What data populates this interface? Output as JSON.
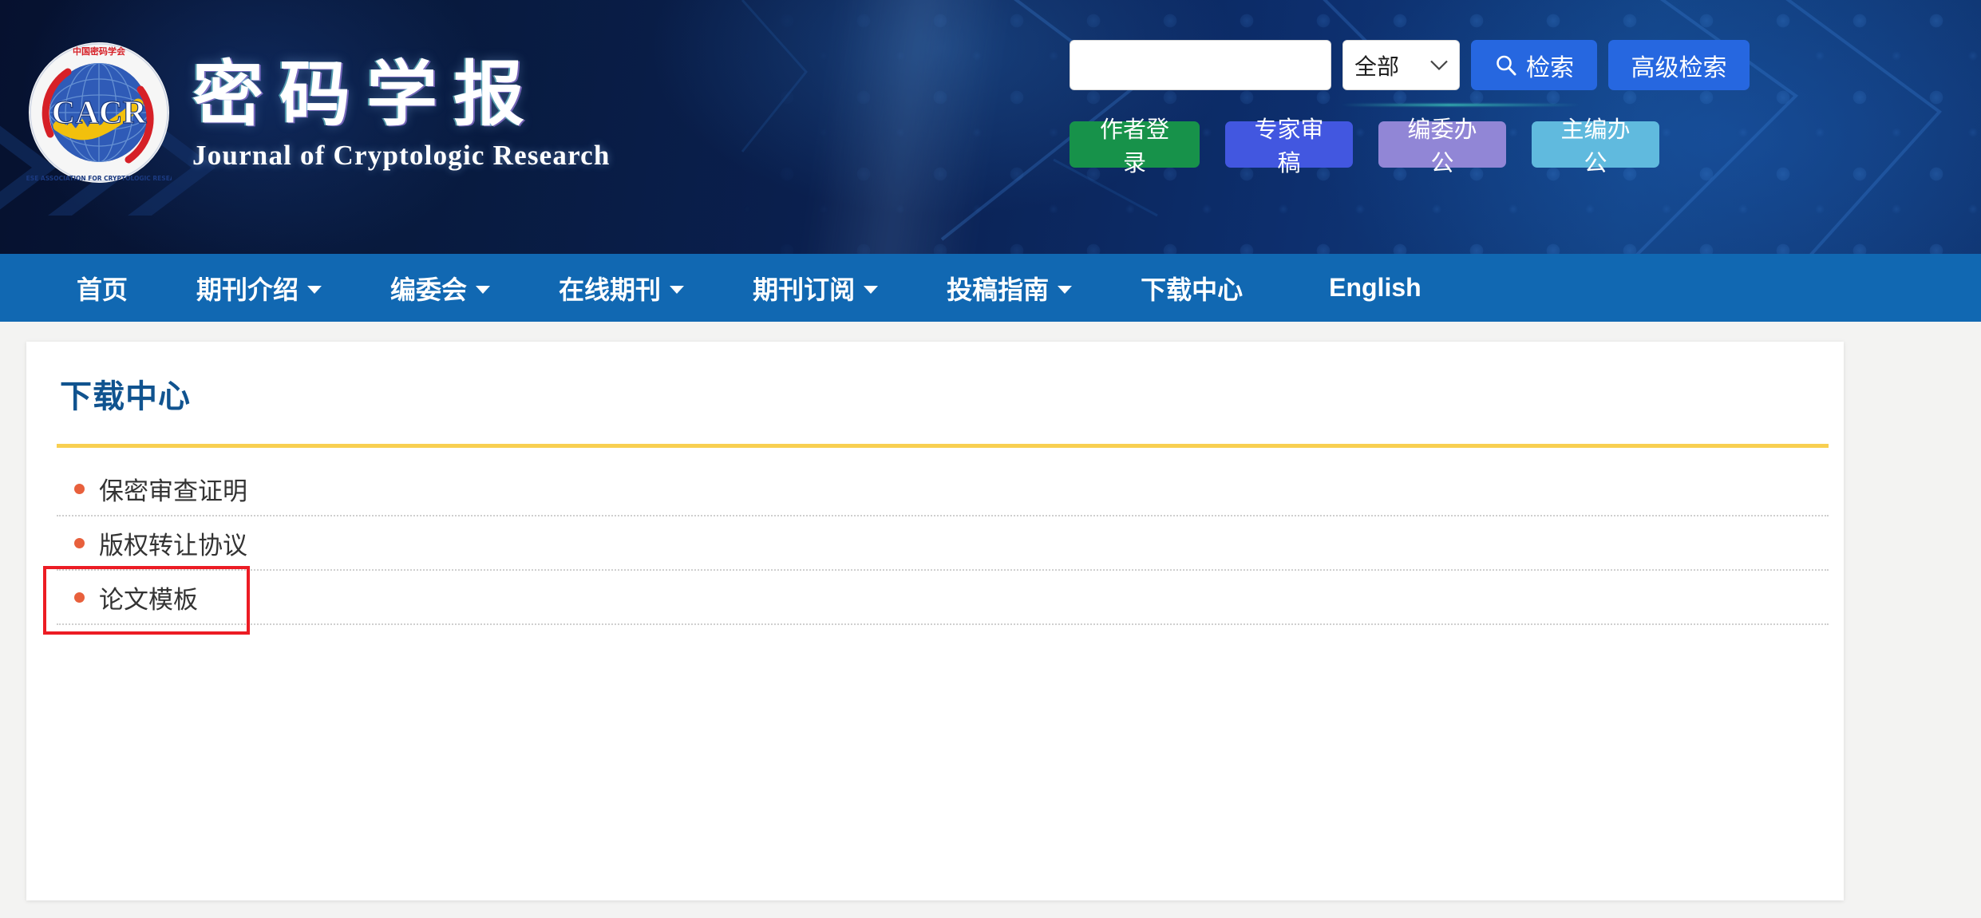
{
  "site": {
    "logo_icon": "cacr-emblem-icon",
    "title_cn": "密码学报",
    "title_en": "Journal of Cryptologic Research"
  },
  "search": {
    "query_value": "",
    "placeholder": "",
    "scope_selected": "全部",
    "scope_chevron_icon": "chevron-down-icon",
    "search_icon": "search-icon",
    "search_label": "检索",
    "advanced_label": "高级检索"
  },
  "account_buttons": [
    {
      "label": "作者登录",
      "color": "#17924a"
    },
    {
      "label": "专家审稿",
      "color": "#4257e0"
    },
    {
      "label": "编委办公",
      "color": "#9186d6"
    },
    {
      "label": "主编办公",
      "color": "#60bade"
    }
  ],
  "nav": {
    "bg_color": "#1168b2",
    "items": [
      {
        "label": "首页",
        "has_caret": false
      },
      {
        "label": "期刊介绍",
        "has_caret": true
      },
      {
        "label": "编委会",
        "has_caret": true
      },
      {
        "label": "在线期刊",
        "has_caret": true
      },
      {
        "label": "期刊订阅",
        "has_caret": true
      },
      {
        "label": "投稿指南",
        "has_caret": true
      },
      {
        "label": "下载中心",
        "has_caret": false
      },
      {
        "label": "English",
        "has_caret": false
      }
    ]
  },
  "main": {
    "page_title": "下载中心",
    "title_color": "#10538f",
    "rule_color": "#f8cf51",
    "bullet_color": "#e8603c",
    "highlight_color": "#ec1c24",
    "downloads": [
      {
        "label": "保密审查证明",
        "highlighted": false
      },
      {
        "label": "版权转让协议",
        "highlighted": false
      },
      {
        "label": "论文模板",
        "highlighted": true
      }
    ]
  }
}
